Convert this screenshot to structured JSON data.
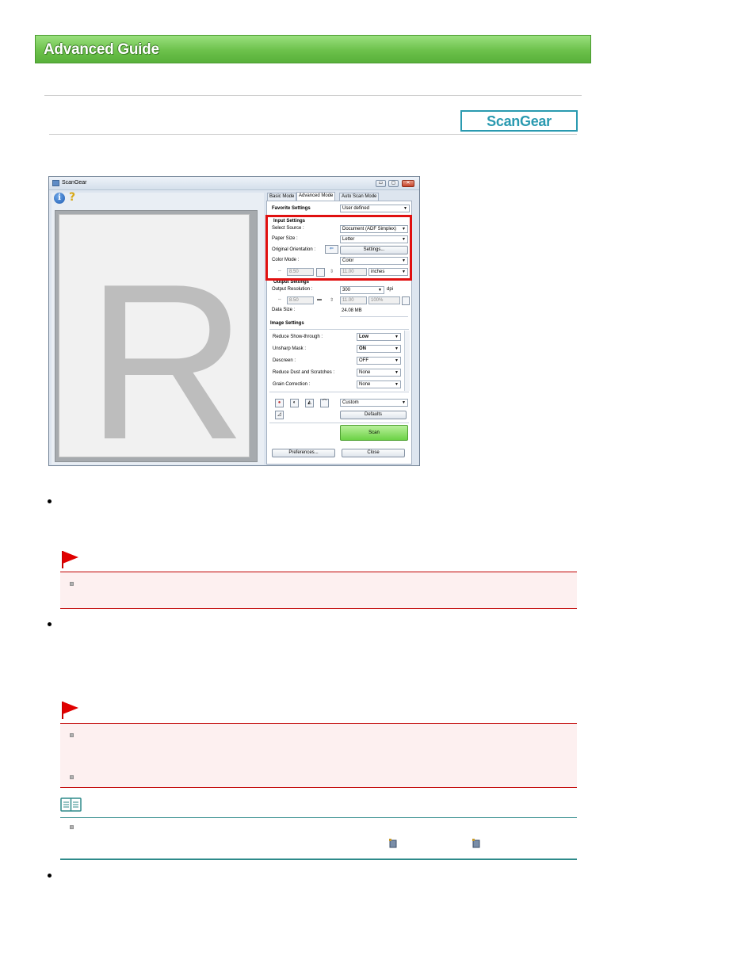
{
  "header": {
    "title": "Advanced Guide"
  },
  "badge": {
    "label": "ScanGear"
  },
  "window": {
    "title": "ScanGear",
    "controls": {
      "minimize": "▭",
      "maximize": "◻",
      "close": "✕"
    },
    "info_glyph": "i",
    "help_glyph": "?",
    "preview_letter": "R",
    "tabs": [
      "Basic Mode",
      "Advanced Mode",
      "Auto Scan Mode"
    ],
    "favorite_settings": {
      "label": "Favorite Settings",
      "value": "User defined"
    },
    "input_settings": {
      "heading": "Input Settings",
      "select_source": {
        "label": "Select Source :",
        "value": "Document (ADF Simplex)"
      },
      "paper_size": {
        "label": "Paper Size :",
        "value": "Letter"
      },
      "original_orientation": {
        "label": "Original Orientation :",
        "button": "Settings..."
      },
      "color_mode": {
        "label": "Color Mode :",
        "value": "Color"
      },
      "width": "8.50",
      "height": "11.00",
      "unit": "inches"
    },
    "output_settings": {
      "heading": "Output Settings",
      "resolution": {
        "label": "Output Resolution :",
        "value": "300",
        "unit": "dpi"
      },
      "width": "8.50",
      "height": "11.00",
      "scale": "100%",
      "data_size": {
        "label": "Data Size :",
        "value": "24.08 MB"
      }
    },
    "image_settings": {
      "heading": "Image Settings",
      "rows": [
        {
          "label": "Reduce Show-through :",
          "value": "Low"
        },
        {
          "label": "Unsharp Mask :",
          "value": "ON"
        },
        {
          "label": "Descreen :",
          "value": "OFF"
        },
        {
          "label": "Reduce Dust and Scratches :",
          "value": "None"
        },
        {
          "label": "Grain Correction :",
          "value": "None"
        }
      ]
    },
    "tone": {
      "value": "Custom",
      "defaults_button": "Defaults"
    },
    "scan_button": "Scan",
    "preferences_button": "Preferences...",
    "close_button": "Close"
  }
}
